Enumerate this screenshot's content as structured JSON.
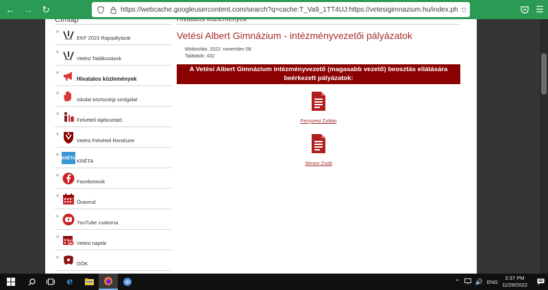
{
  "browser": {
    "url": "https://webcache.googleusercontent.com/search?q=cache:T_Va9_1TT4UJ:https://vetesigimnazium.hu/index.php/hivatalos-kozlem"
  },
  "sidebar": {
    "title": "Címlap",
    "items": [
      {
        "label": "EKF 2023 Rajzpályázat",
        "icon": "ekf-logo-icon",
        "bold": false
      },
      {
        "label": "Vetési Találkozások",
        "icon": "ekf-logo-icon",
        "bold": false
      },
      {
        "label": "Hivatalos közlemények",
        "icon": "megaphone-icon",
        "bold": true
      },
      {
        "label": "Iskolai közösségi szolgálat",
        "icon": "hand-icon",
        "bold": false
      },
      {
        "label": "Felvételi tájékoztató",
        "icon": "people-icon",
        "bold": false
      },
      {
        "label": "Vetési Felvételi Rendszer",
        "icon": "school-crest-icon",
        "bold": false
      },
      {
        "label": "KRÉTA",
        "icon": "kreta-logo-icon",
        "bold": false
      },
      {
        "label": "Facebooook",
        "icon": "facebook-icon",
        "bold": false
      },
      {
        "label": "Órarend",
        "icon": "timetable-icon",
        "bold": false
      },
      {
        "label": "YouTube csatorna",
        "icon": "youtube-icon",
        "bold": false
      },
      {
        "label": "Vetési naptár",
        "icon": "calendar-icon",
        "bold": false
      },
      {
        "label": "DÖK",
        "icon": "dok-logo-icon",
        "bold": false
      }
    ]
  },
  "main": {
    "section_title": "Hivatalos közlemények",
    "article_title": "Vetési Albert Gimnázium - intézményvezetői pályázatok",
    "modified": "Módosítás: 2022. november 08.",
    "hits": "Találatok: 432",
    "banner": "A Vetési Albert Gimnázium intézményvezető (magasabb vezető) beosztás ellátására beérkezett pályázatok:",
    "documents": [
      {
        "name": "Fenyvesi Zoltán"
      },
      {
        "name": "Simon Zsolt"
      }
    ]
  },
  "taskbar": {
    "language": "ENG",
    "time": "2:37 PM",
    "date": "11/29/2022"
  },
  "colors": {
    "accent": "#2b9a54",
    "brand_red": "#a52a2a",
    "banner": "#8b0000"
  }
}
